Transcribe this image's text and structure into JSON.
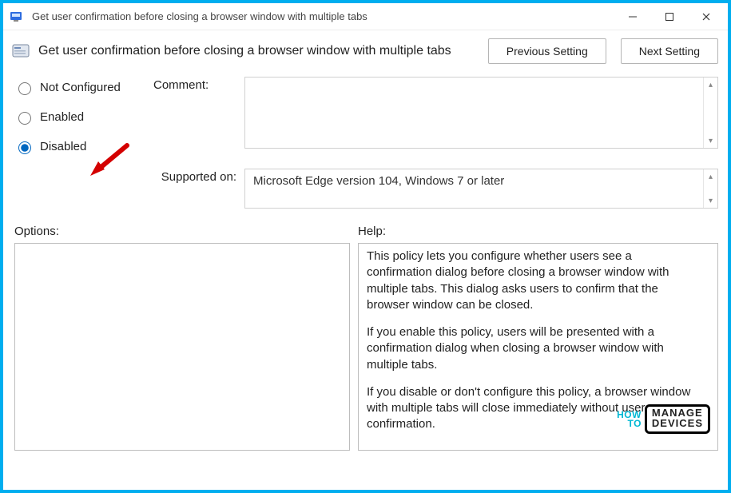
{
  "window": {
    "title": "Get user confirmation before closing a browser window with multiple tabs"
  },
  "header": {
    "title": "Get user confirmation before closing a browser window with multiple tabs",
    "prev_label": "Previous Setting",
    "next_label": "Next Setting"
  },
  "radios": {
    "not_configured": "Not Configured",
    "enabled": "Enabled",
    "disabled": "Disabled",
    "selected": "disabled"
  },
  "labels": {
    "comment": "Comment:",
    "supported_on": "Supported on:",
    "options": "Options:",
    "help": "Help:"
  },
  "comment_text": "",
  "supported_on_text": "Microsoft Edge version 104, Windows 7 or later",
  "help_text": {
    "p1": "This policy lets you configure whether users see a confirmation dialog before closing a browser window with multiple tabs. This dialog asks users to confirm that the browser window can be closed.",
    "p2": "If you enable this policy, users will be presented with a confirmation dialog when closing a browser window with multiple tabs.",
    "p3": "If you disable or don't configure this policy, a browser window with multiple tabs will close immediately without user confirmation."
  },
  "watermark": {
    "how": "HOW",
    "to": "TO",
    "manage": "MANAGE",
    "devices": "DEVICES"
  }
}
